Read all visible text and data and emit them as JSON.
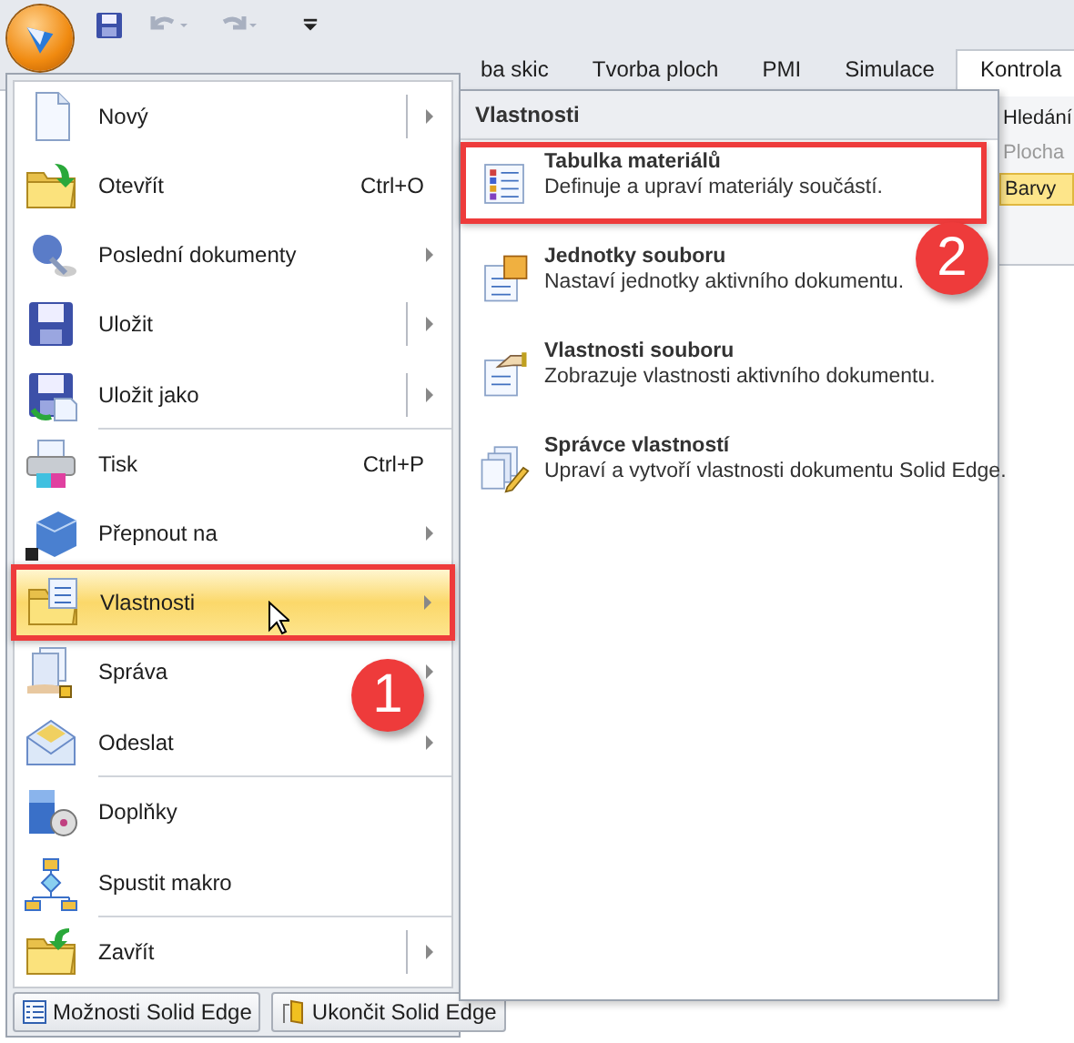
{
  "tabs": [
    {
      "label": "ba skic",
      "selected": false
    },
    {
      "label": "Tvorba ploch",
      "selected": false
    },
    {
      "label": "PMI",
      "selected": false
    },
    {
      "label": "Simulace",
      "selected": false
    },
    {
      "label": "Kontrola",
      "selected": true
    }
  ],
  "ribbon_fragments": [
    {
      "text": "Hledání",
      "kind": "label"
    },
    {
      "text": "Plocha",
      "kind": "disabled"
    },
    {
      "text": "Barvy",
      "kind": "highlighted"
    }
  ],
  "app_menu": {
    "items": [
      {
        "label": "Nový",
        "submenu": true,
        "split": true,
        "separator_after": false,
        "selected": false,
        "annotated": false
      },
      {
        "label": "Otevřít",
        "shortcut": "Ctrl+O",
        "submenu": false,
        "split": false,
        "separator_after": false,
        "selected": false,
        "annotated": false
      },
      {
        "label": "Poslední dokumenty",
        "submenu": true,
        "split": false,
        "separator_after": false,
        "selected": false,
        "annotated": false
      },
      {
        "label": "Uložit",
        "submenu": true,
        "split": true,
        "separator_after": false,
        "selected": false,
        "annotated": false
      },
      {
        "label": "Uložit jako",
        "submenu": true,
        "split": true,
        "separator_after": true,
        "selected": false,
        "annotated": false
      },
      {
        "label": "Tisk",
        "shortcut": "Ctrl+P",
        "submenu": false,
        "split": false,
        "separator_after": false,
        "selected": false,
        "annotated": false
      },
      {
        "label": "Přepnout na",
        "submenu": true,
        "split": false,
        "separator_after": false,
        "selected": false,
        "annotated": false
      },
      {
        "label": "Vlastnosti",
        "submenu": true,
        "split": false,
        "separator_after": false,
        "selected": true,
        "annotated": true
      },
      {
        "label": "Správa",
        "submenu": true,
        "split": false,
        "separator_after": false,
        "selected": false,
        "annotated": false
      },
      {
        "label": "Odeslat",
        "submenu": true,
        "split": false,
        "separator_after": true,
        "selected": false,
        "annotated": false
      },
      {
        "label": "Doplňky",
        "submenu": false,
        "split": false,
        "separator_after": false,
        "selected": false,
        "annotated": false
      },
      {
        "label": "Spustit makro",
        "submenu": false,
        "split": false,
        "separator_after": true,
        "selected": false,
        "annotated": false
      },
      {
        "label": "Zavřít",
        "submenu": true,
        "split": true,
        "separator_after": false,
        "selected": false,
        "annotated": false
      }
    ],
    "footer_buttons": [
      "Možnosti Solid Edge",
      "Ukončit Solid Edge"
    ]
  },
  "submenu": {
    "title": "Vlastnosti",
    "items": [
      {
        "title": "Tabulka materiálů",
        "description": "Definuje a upraví materiály součástí.",
        "annotated": true
      },
      {
        "title": "Jednotky souboru",
        "description": "Nastaví jednotky aktivního dokumentu.",
        "annotated": false
      },
      {
        "title": "Vlastnosti souboru",
        "description": "Zobrazuje vlastnosti aktivního dokumentu.",
        "annotated": false
      },
      {
        "title": "Správce vlastností",
        "description": "Upraví a vytvoří vlastnosti dokumentu Solid Edge.",
        "annotated": false
      }
    ]
  },
  "callouts": [
    {
      "text": "1"
    },
    {
      "text": "2"
    }
  ]
}
